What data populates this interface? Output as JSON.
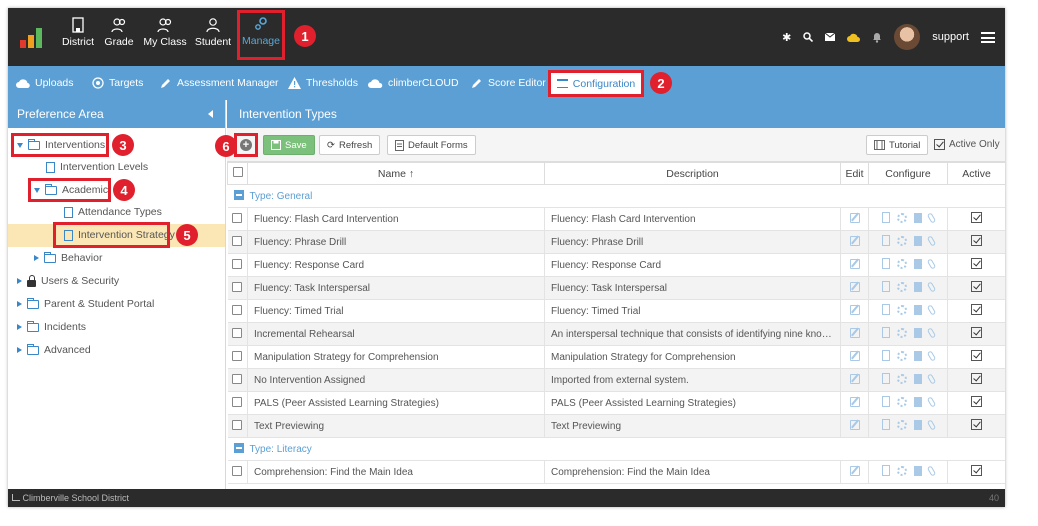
{
  "nav": {
    "items": [
      {
        "label": "District",
        "icon": "building-icon"
      },
      {
        "label": "Grade",
        "icon": "users-icon"
      },
      {
        "label": "My Class",
        "icon": "users-icon"
      },
      {
        "label": "Student",
        "icon": "user-icon"
      },
      {
        "label": "Manage",
        "icon": "gears-icon"
      }
    ],
    "user": "support"
  },
  "toolbar": {
    "items": [
      {
        "label": "Uploads",
        "icon": "cloud-upload-icon"
      },
      {
        "label": "Targets",
        "icon": "target-icon"
      },
      {
        "label": "Assessment Manager",
        "icon": "pencil-icon"
      },
      {
        "label": "Thresholds",
        "icon": "warning-icon"
      },
      {
        "label": "climberCLOUD",
        "icon": "cloud-icon"
      },
      {
        "label": "Score Editor",
        "icon": "pencil-icon"
      }
    ],
    "active": "Configuration"
  },
  "badges": [
    "1",
    "2",
    "3",
    "4",
    "5",
    "6"
  ],
  "left": {
    "title": "Preference Area",
    "tree": [
      "Interventions",
      "Intervention Levels",
      "Academic",
      "Attendance Types",
      "Intervention Strategy",
      "Behavior",
      "Users & Security",
      "Parent & Student Portal",
      "Incidents",
      "Advanced"
    ]
  },
  "right": {
    "title": "Intervention Types",
    "buttons": {
      "save": "Save",
      "refresh": "Refresh",
      "default_forms": "Default Forms",
      "tutorial": "Tutorial",
      "active_only": "Active Only"
    },
    "columns": {
      "name": "Name",
      "name_sort": "↑",
      "description": "Description",
      "edit": "Edit",
      "configure": "Configure",
      "active": "Active"
    },
    "groups": [
      {
        "label": "Type: General",
        "rows": [
          {
            "name": "Fluency: Flash Card Intervention",
            "description": "Fluency: Flash Card Intervention"
          },
          {
            "name": "Fluency: Phrase Drill",
            "description": "Fluency: Phrase Drill"
          },
          {
            "name": "Fluency: Response Card",
            "description": "Fluency: Response Card"
          },
          {
            "name": "Fluency: Task Interspersal",
            "description": "Fluency: Task Interspersal"
          },
          {
            "name": "Fluency: Timed Trial",
            "description": "Fluency: Timed Trial"
          },
          {
            "name": "Incremental Rehearsal",
            "description": "An interspersal technique that consists of identifying nine known f..."
          },
          {
            "name": "Manipulation Strategy for Comprehension",
            "description": "Manipulation Strategy for Comprehension"
          },
          {
            "name": "No Intervention Assigned",
            "description": "Imported from external system."
          },
          {
            "name": "PALS (Peer Assisted Learning Strategies)",
            "description": "PALS (Peer Assisted Learning Strategies)"
          },
          {
            "name": "Text Previewing",
            "description": "Text Previewing"
          }
        ]
      },
      {
        "label": "Type: Literacy",
        "rows": [
          {
            "name": "Comprehension: Find the Main Idea",
            "description": "Comprehension: Find the Main Idea"
          }
        ]
      }
    ]
  },
  "footer": {
    "org": "Climberville School District",
    "num": "40"
  },
  "colors": {
    "accent": "#5b9fd4",
    "highlight": "#e0202c",
    "topbar": "#2b2b2b",
    "selected_row": "#fbe7b5"
  }
}
